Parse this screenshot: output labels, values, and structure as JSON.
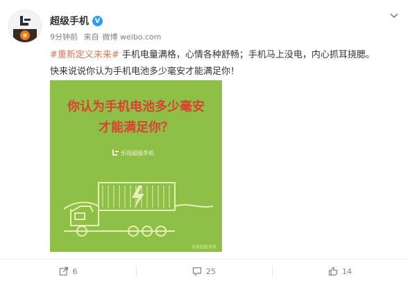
{
  "post": {
    "author": "超级手机",
    "verified_mark": "V",
    "time": "9分钟前",
    "source_prefix": "来自",
    "source": "微博 weibo.com",
    "topic": "#重新定义未来#",
    "body_line1": " 手机电量满格，心情各种舒畅；手机马上没电，内心抓耳挠腮。",
    "body_line2": "快来说说你认为手机电池多少毫安才能满足你！"
  },
  "image": {
    "headline_line1": "你认为手机电池多少毫安",
    "headline_line2": "才能满足你？",
    "brand": "乐视超级手机",
    "watermark": "乐视超级手机",
    "bg_color": "#8ebf47",
    "headline_color": "#d8432f",
    "line_color": "#e8f0b8"
  },
  "actions": {
    "forward_count": "6",
    "comment_count": "25",
    "like_count": "14"
  },
  "icons": [
    "le-logo-icon",
    "verified-icon",
    "chevron-down-icon",
    "forward-icon",
    "comment-icon",
    "like-icon",
    "lightning-icon"
  ]
}
